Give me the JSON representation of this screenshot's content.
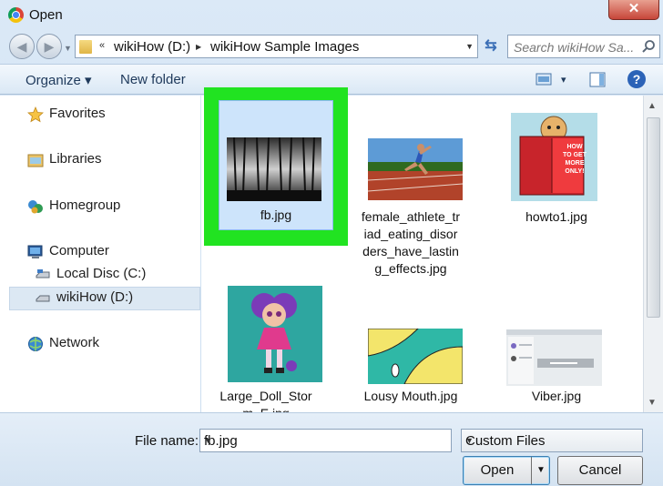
{
  "window": {
    "title": "Open",
    "close_glyph": "✕"
  },
  "nav": {
    "back_glyph": "◀",
    "forward_glyph": "▶",
    "dropdown_glyph": "▼",
    "address": {
      "chevron1": "«",
      "seg1": "wikiHow (D:)",
      "chevron2": "▶",
      "seg2": "wikiHow Sample Images",
      "dropdown_glyph": "▼"
    },
    "refresh_glyph": "⇆",
    "search_placeholder": "Search wikiHow Sa..."
  },
  "toolbar": {
    "organize": "Organize ▾",
    "new_folder": "New folder",
    "views_glyph": "▾",
    "help_glyph": "?"
  },
  "sidebar": {
    "favorites": "Favorites",
    "libraries": "Libraries",
    "homegroup": "Homegroup",
    "computer": "Computer",
    "local_disc": "Local Disc (C:)",
    "wikihow_d": "wikiHow (D:)",
    "network": "Network"
  },
  "files": [
    {
      "name": "fb.jpg"
    },
    {
      "name": "female_athlete_triad_eating_disorders_have_lasting_effects.jpg",
      "lines": [
        "female_athlete_tr",
        "iad_eating_disor",
        "ders_have_lastin",
        "g_effects.jpg"
      ]
    },
    {
      "name": "howto1.jpg",
      "book_text": [
        "HOW",
        "TO GET",
        "MORE",
        "ONLY!"
      ]
    },
    {
      "name": "Large_Doll_Storm_E.jpg",
      "lines": [
        "Large_Doll_Stor",
        "m_E.jpg"
      ]
    },
    {
      "name": "Lousy Mouth.jpg"
    },
    {
      "name": "Viber.jpg"
    }
  ],
  "bottom": {
    "filename_label": "File name:",
    "filename_value": "fb.jpg",
    "filetype_value": "Custom Files",
    "dropdown_glyph": "▼",
    "open_label": "Open",
    "open_split_glyph": "▼",
    "cancel_label": "Cancel"
  },
  "colors": {
    "highlight": "#21e321",
    "selection": "#cde4fb"
  }
}
